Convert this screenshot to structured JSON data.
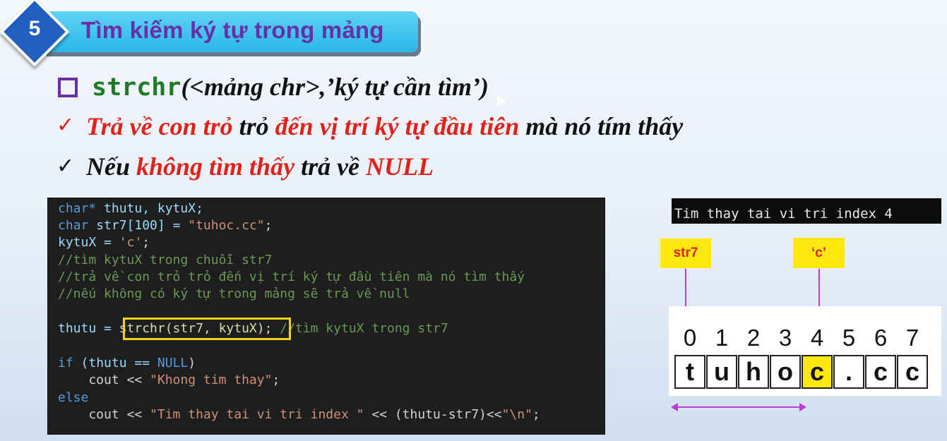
{
  "slide": {
    "number": "5",
    "title": "Tìm kiếm ký tự trong mảng"
  },
  "bullets": {
    "syntax_fn": "strchr",
    "syntax_args": "(<mảng chr>,’ký tự cần tìm’)",
    "line1": [
      "Trả về con trỏ",
      " trỏ ",
      "đến vị trí ký tự đầu tiên",
      " mà nó tím thấy"
    ],
    "line2": [
      "Nếu ",
      "không tìm thấy",
      " trả về ",
      "NULL"
    ]
  },
  "code": {
    "l1a": "char*",
    "l1b": " thutu, kytuX;",
    "l2a": "char",
    "l2b": " str7[100] = ",
    "l2c": "\"tuhoc.cc\"",
    "l2d": ";",
    "l3a": "kytuX = ",
    "l3b": "'c'",
    "l3c": ";",
    "c1": "//tìm kytuX trong chuỗi str7",
    "c2": "//trả về con trỏ trỏ đến vị trí ký tự đầu tiên mà nó tìm thấy",
    "c3": "//nếu không có ký tự trong mảng sẽ trả về null",
    "l4a": "thutu = ",
    "l4b": "strchr(str7, kytuX);",
    "l4c": " //tìm kytuX trong str7",
    "l5a": "if",
    "l5b": " (thutu == ",
    "l5c": "NULL",
    "l5d": ")",
    "l6a": "    cout << ",
    "l6b": "\"Khong tim thay\"",
    "l6c": ";",
    "l7": "else",
    "l8a": "    cout << ",
    "l8b": "\"Tim thay tai vi tri index \"",
    "l8c": " << (thutu-str7)<<",
    "l8d": "\"\\n\"",
    "l8e": ";"
  },
  "console_output": "Tim thay tai vi tri index 4",
  "diagram": {
    "label_array": "str7",
    "label_char": "‘c’",
    "indices": [
      "0",
      "1",
      "2",
      "3",
      "4",
      "5",
      "6",
      "7"
    ],
    "chars": [
      "t",
      "u",
      "h",
      "o",
      "c",
      ".",
      "c",
      "c"
    ],
    "selected_index": 4,
    "highlight_color": "#ffe80f",
    "arrow_color": "#c03ad8"
  }
}
